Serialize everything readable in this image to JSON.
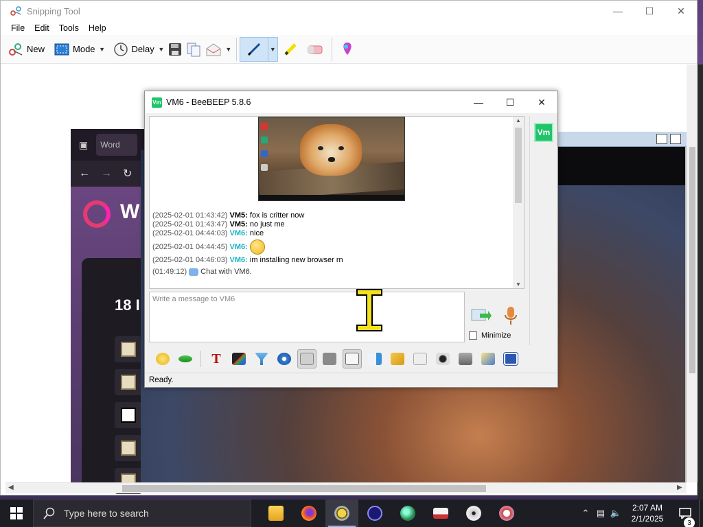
{
  "snip": {
    "title": "Snipping Tool",
    "menu": [
      "File",
      "Edit",
      "Tools",
      "Help"
    ],
    "toolbar": {
      "new_label": "New",
      "mode_label": "Mode",
      "delay_label": "Delay"
    }
  },
  "captured": {
    "browser_tab_label": "Word",
    "page_heading": "W",
    "card_text": "18 I"
  },
  "beebeep": {
    "title": "VM6 - BeeBEEP 5.8.6",
    "avatar_label": "Vm",
    "messages": [
      {
        "ts": "(2025-02-01 01:43:42)",
        "nick": "VM5",
        "text": " fox is critter now"
      },
      {
        "ts": "(2025-02-01 01:43:47)",
        "nick": "VM5",
        "text": " no just me"
      },
      {
        "ts": "(2025-02-01 04:44:03)",
        "nick": "VM6",
        "text": " nice"
      },
      {
        "ts": "(2025-02-01 04:44:45)",
        "nick": "VM6",
        "text": ""
      },
      {
        "ts": "(2025-02-01 04:46:03)",
        "nick": "VM6",
        "text": " im installing new browser rn"
      }
    ],
    "system_msg": {
      "ts": "(01:49:12)",
      "text": "Chat with VM6."
    },
    "input_placeholder": "Write a message to VM6",
    "minimize_label": "Minimize",
    "status": "Ready."
  },
  "taskbar": {
    "search_placeholder": "Type here to search",
    "time": "2:07 AM",
    "date": "2/1/2025",
    "notification_count": "3"
  }
}
